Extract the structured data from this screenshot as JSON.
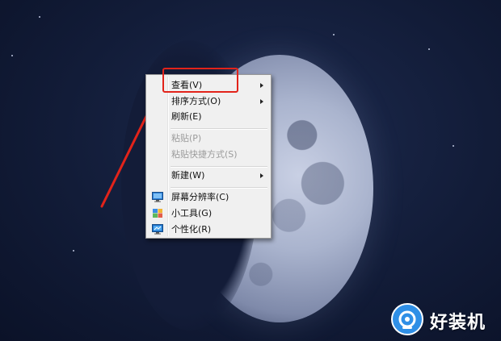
{
  "context_menu": {
    "items": [
      {
        "label": "查看(V)",
        "has_submenu": true,
        "disabled": false,
        "icon": ""
      },
      {
        "label": "排序方式(O)",
        "has_submenu": true,
        "disabled": false,
        "icon": ""
      },
      {
        "label": "刷新(E)",
        "has_submenu": false,
        "disabled": false,
        "icon": ""
      },
      {
        "label": "粘贴(P)",
        "has_submenu": false,
        "disabled": true,
        "icon": ""
      },
      {
        "label": "粘贴快捷方式(S)",
        "has_submenu": false,
        "disabled": true,
        "icon": ""
      },
      {
        "label": "新建(W)",
        "has_submenu": true,
        "disabled": false,
        "icon": ""
      },
      {
        "label": "屏幕分辨率(C)",
        "has_submenu": false,
        "disabled": false,
        "icon": "monitor-icon"
      },
      {
        "label": "小工具(G)",
        "has_submenu": false,
        "disabled": false,
        "icon": "gadgets-icon"
      },
      {
        "label": "个性化(R)",
        "has_submenu": false,
        "disabled": false,
        "icon": "personalize-icon"
      }
    ]
  },
  "annotation": {
    "highlight_color": "#e2231a",
    "arrow_color": "#e2231a"
  },
  "watermark": {
    "text": "好装机",
    "logo_color": "#2f8fe6"
  },
  "colors": {
    "desktop_bg": "#121c38",
    "menu_bg": "#f0f0f0",
    "disabled_text": "#9b9b9b"
  }
}
